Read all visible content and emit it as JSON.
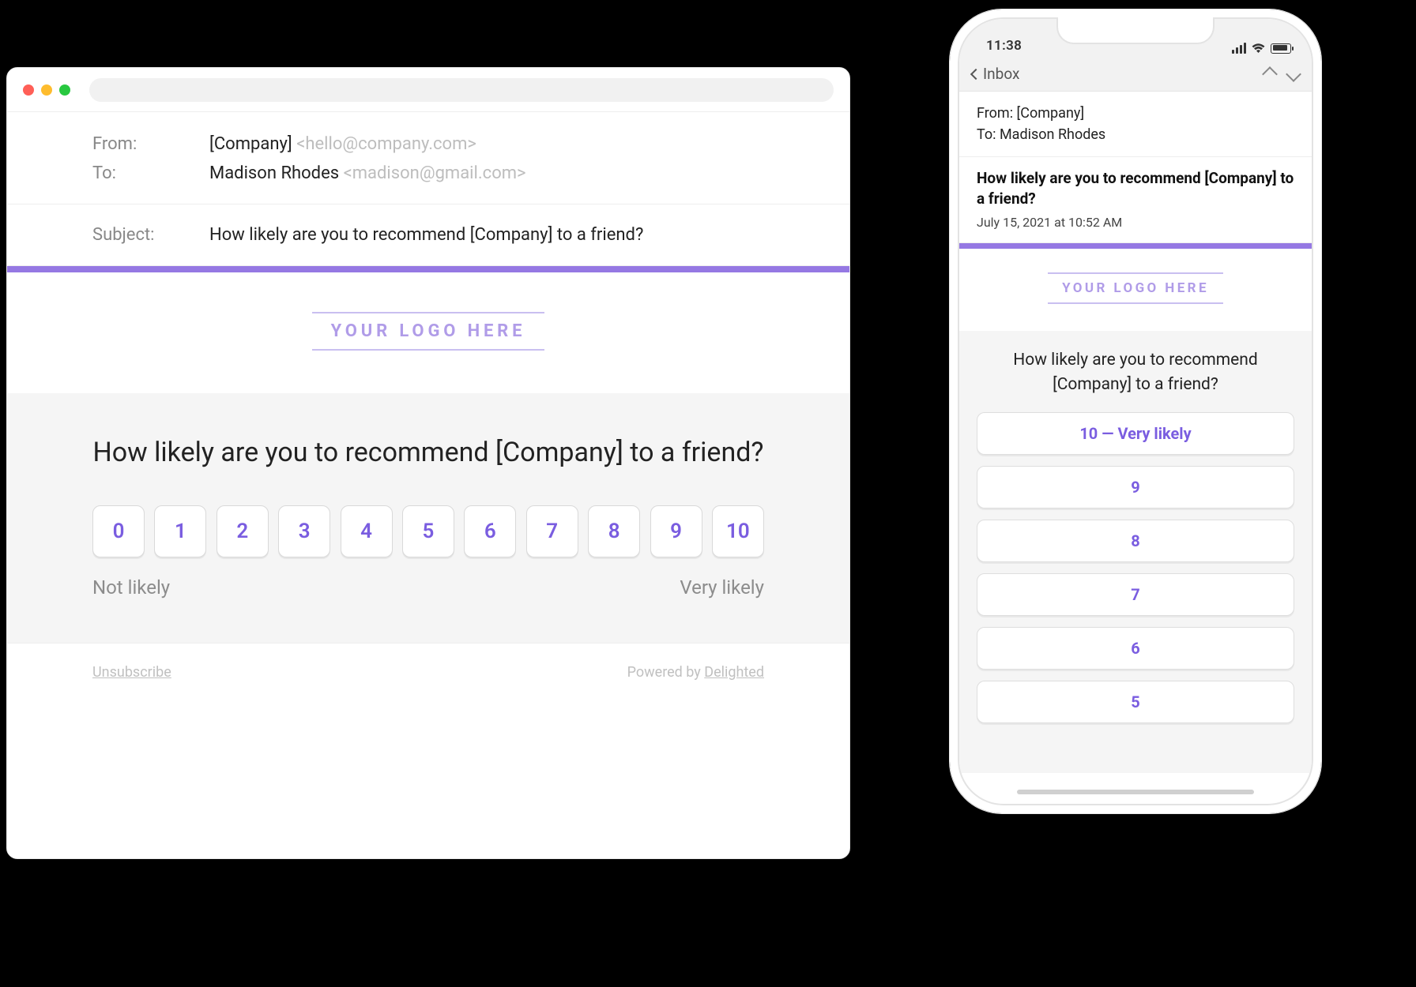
{
  "desktop": {
    "headers": {
      "from_label": "From:",
      "from_name": "[Company]",
      "from_addr": "<hello@company.com>",
      "to_label": "To:",
      "to_name": "Madison Rhodes",
      "to_addr": "<madison@gmail.com>",
      "subject_label": "Subject:",
      "subject": "How likely are you to recommend [Company] to a friend?"
    },
    "logo_text": "YOUR LOGO HERE",
    "question": "How likely are you to recommend [Company] to a friend?",
    "scale": [
      "0",
      "1",
      "2",
      "3",
      "4",
      "5",
      "6",
      "7",
      "8",
      "9",
      "10"
    ],
    "scale_low": "Not likely",
    "scale_high": "Very likely",
    "unsubscribe": "Unsubscribe",
    "powered_prefix": "Powered by ",
    "powered_brand": "Delighted"
  },
  "phone": {
    "status_time": "11:38",
    "nav_back": "Inbox",
    "from_line": "From: [Company]",
    "to_line": "To: Madison Rhodes",
    "subject": "How likely are you to recommend [Company] to a friend?",
    "date": "July 15, 2021 at 10:52 AM",
    "logo_text": "YOUR LOGO HERE",
    "question": "How likely are you to recommend [Company] to a friend?",
    "buttons": [
      "10 — Very likely",
      "9",
      "8",
      "7",
      "6",
      "5"
    ]
  },
  "colors": {
    "accent": "#9578e3"
  }
}
